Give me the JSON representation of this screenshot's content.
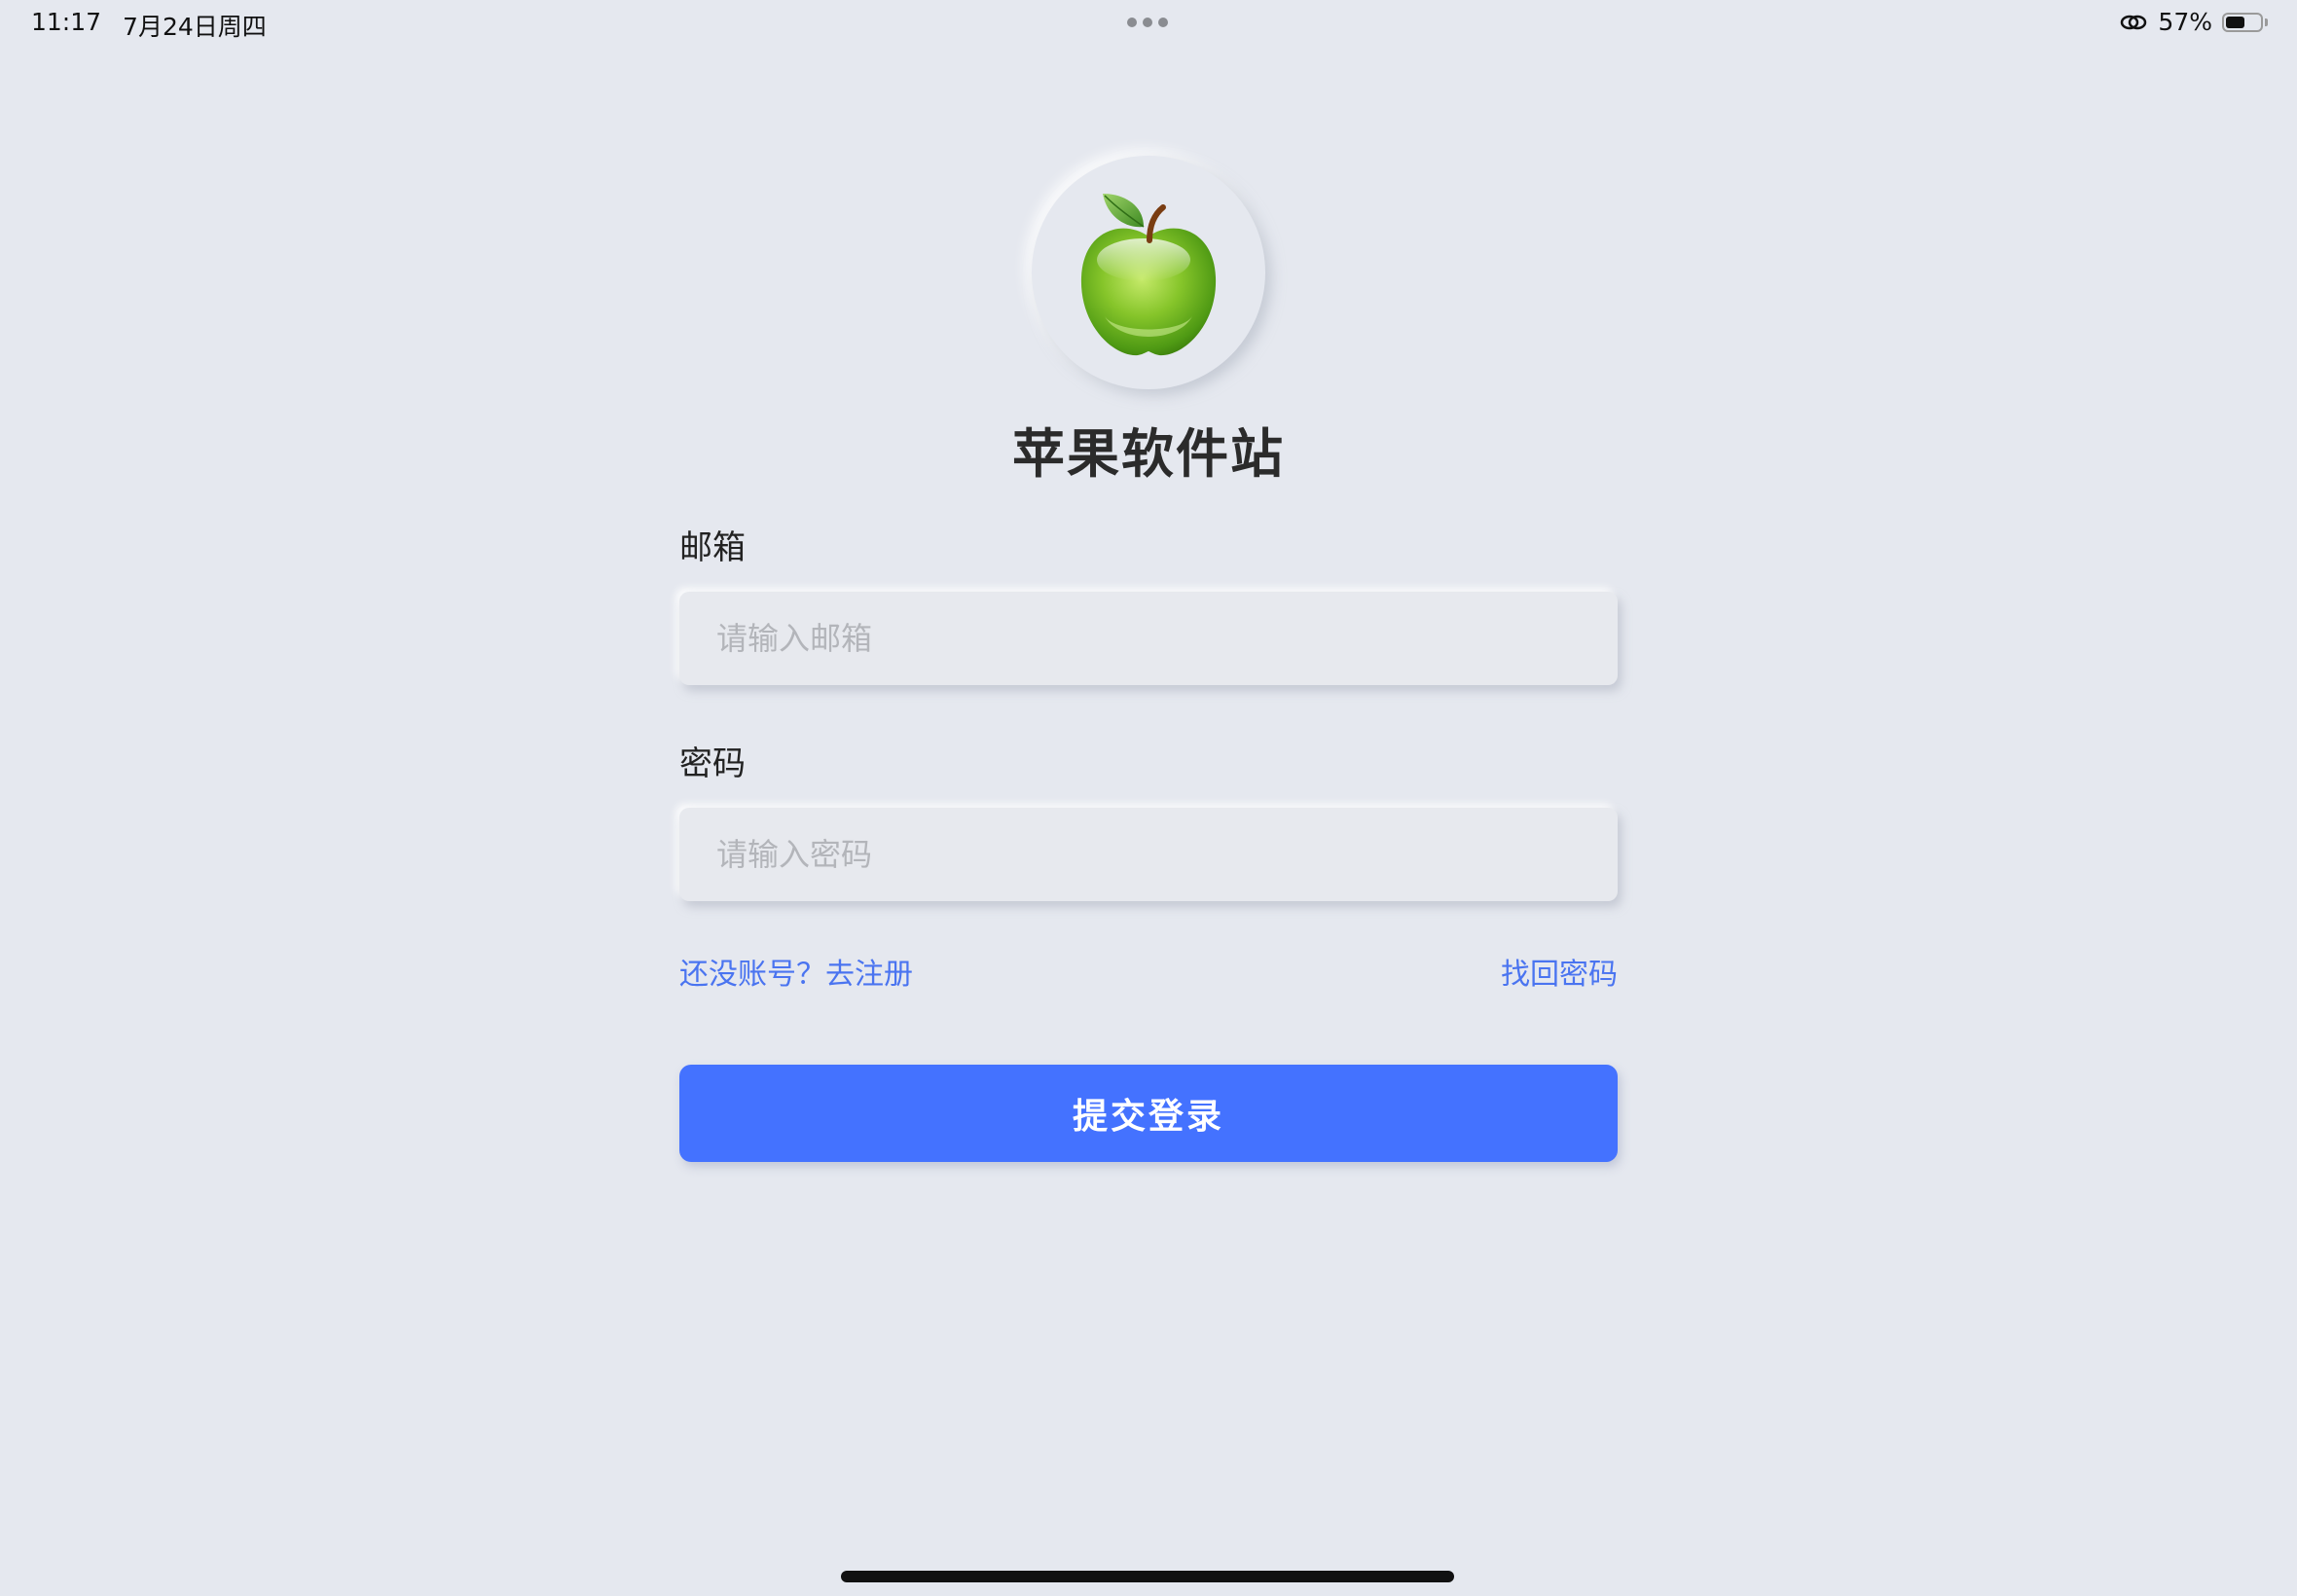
{
  "status_bar": {
    "time": "11:17",
    "date": "7月24日周四",
    "battery_percent": "57%",
    "battery_level": 0.57
  },
  "app": {
    "logo_icon": "green-apple-icon",
    "title": "苹果软件站"
  },
  "form": {
    "email_label": "邮箱",
    "email_placeholder": "请输入邮箱",
    "email_value": "",
    "password_label": "密码",
    "password_placeholder": "请输入密码",
    "password_value": "",
    "register_link": "还没账号？去注册",
    "forgot_link": "找回密码",
    "submit_label": "提交登录"
  },
  "colors": {
    "background": "#e5e8ef",
    "accent": "#4472ff",
    "link": "#4a74f0"
  }
}
